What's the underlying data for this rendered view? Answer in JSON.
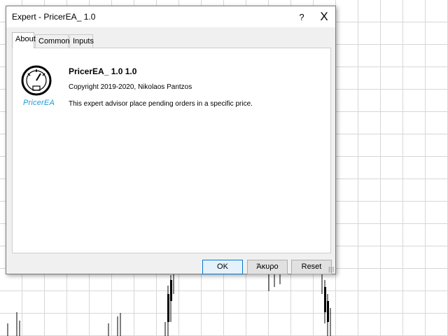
{
  "dialog": {
    "title": "Expert - PricerEA_ 1.0",
    "help_label": "?",
    "close_label": "X",
    "tabs": [
      {
        "label": "About"
      },
      {
        "label": "Common"
      },
      {
        "label": "Inputs"
      }
    ],
    "active_tab": "About",
    "about": {
      "logo_text": "PricerEA",
      "product_name": "PricerEA_ 1.0 1.0",
      "copyright": "Copyright 2019-2020, Nikolaos Pantzos",
      "description": "This expert advisor place pending orders in a specific price."
    },
    "buttons": {
      "ok": "OK",
      "cancel": "Άκυρο",
      "reset": "Reset"
    }
  },
  "colors": {
    "chart_background": "#ffffff",
    "grid": "#b8b8b8",
    "candle": "#000000",
    "logo_accent": "#1f9ad6",
    "ok_border": "#0078d7"
  },
  "icons": [
    "gauge-logo-icon",
    "help-icon",
    "close-icon",
    "resize-grip-icon"
  ]
}
